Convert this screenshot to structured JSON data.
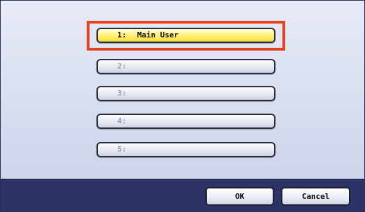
{
  "user_list": {
    "items": [
      {
        "number": "1:",
        "name": "Main User",
        "selected": true
      },
      {
        "number": "2:",
        "name": "",
        "selected": false
      },
      {
        "number": "3:",
        "name": "",
        "selected": false
      },
      {
        "number": "4:",
        "name": "",
        "selected": false
      },
      {
        "number": "5:",
        "name": "",
        "selected": false
      }
    ]
  },
  "footer": {
    "ok_label": "OK",
    "cancel_label": "Cancel"
  },
  "colors": {
    "selected_fill": "#fff17a",
    "highlight_frame": "#e8401f",
    "bottom_bar": "#2d3366"
  }
}
